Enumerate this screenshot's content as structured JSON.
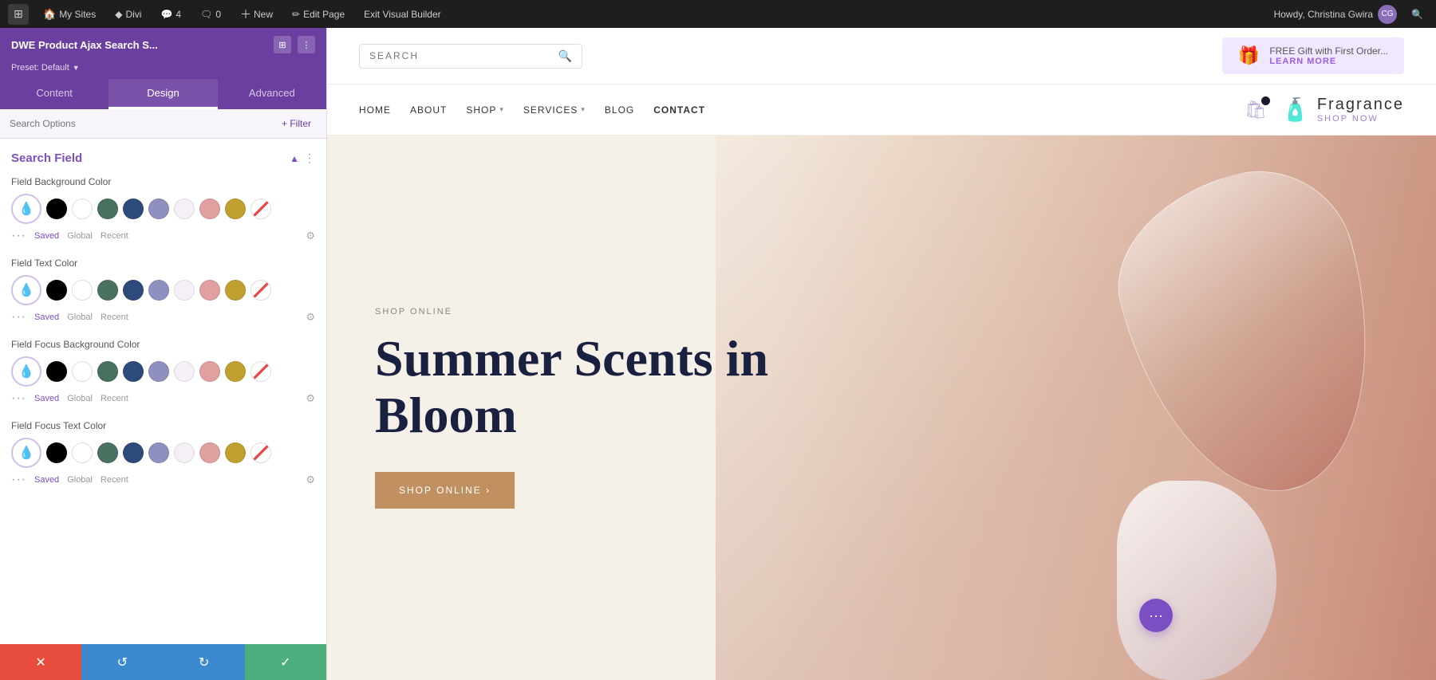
{
  "admin_bar": {
    "wp_logo": "⊞",
    "my_sites_label": "My Sites",
    "divi_label": "Divi",
    "comments_count": "4",
    "comments_label": "4",
    "new_label": "New",
    "edit_page_label": "Edit Page",
    "exit_builder_label": "Exit Visual Builder",
    "howdy_text": "Howdy, Christina Gwira",
    "search_icon": "🔍"
  },
  "panel": {
    "module_name": "DWE Product Ajax Search S...",
    "preset_label": "Preset: Default",
    "tabs": [
      {
        "label": "Content",
        "id": "content"
      },
      {
        "label": "Design",
        "id": "design",
        "active": true
      },
      {
        "label": "Advanced",
        "id": "advanced"
      }
    ],
    "search_placeholder": "Search Options",
    "filter_label": "+ Filter",
    "section_title": "Search Field",
    "field_groups": [
      {
        "label": "Field Background Color",
        "swatches": [
          "#000000",
          "#ffffff",
          "#4a7060",
          "#2d4a7a",
          "#9090c0",
          "#f5f0f5",
          "#e0a0a0",
          "#c0a030",
          "strikethrough"
        ],
        "eyedropper_icon": "💧"
      },
      {
        "label": "Field Text Color",
        "swatches": [
          "#000000",
          "#ffffff",
          "#4a7060",
          "#2d4a7a",
          "#9090c0",
          "#f5f0f5",
          "#e0a0a0",
          "#c0a030",
          "strikethrough"
        ],
        "eyedropper_icon": "💧"
      },
      {
        "label": "Field Focus Background Color",
        "swatches": [
          "#000000",
          "#ffffff",
          "#4a7060",
          "#2d4a7a",
          "#9090c0",
          "#f5f0f5",
          "#e0a0a0",
          "#c0a030",
          "strikethrough"
        ],
        "eyedropper_icon": "💧"
      },
      {
        "label": "Field Focus Text Color",
        "swatches": [
          "#000000",
          "#ffffff",
          "#4a7060",
          "#2d4a7a",
          "#9090c0",
          "#f5f0f5",
          "#e0a0a0",
          "#c0a030",
          "strikethrough"
        ],
        "eyedropper_icon": "💧"
      }
    ],
    "color_tab_saved": "Saved",
    "color_tab_global": "Global",
    "color_tab_recent": "Recent",
    "action_buttons": {
      "cancel": "✕",
      "undo": "↺",
      "redo": "↻",
      "save": "✓"
    }
  },
  "site": {
    "search_placeholder": "SEARCH",
    "promo_text": "FREE Gift with First Order...",
    "promo_link": "LEARN MORE",
    "nav_items": [
      {
        "label": "HOME",
        "has_dropdown": false
      },
      {
        "label": "ABOUT",
        "has_dropdown": false
      },
      {
        "label": "SHOP",
        "has_dropdown": true
      },
      {
        "label": "SERVICES",
        "has_dropdown": true
      },
      {
        "label": "BLOG",
        "has_dropdown": false
      },
      {
        "label": "CONTACT",
        "has_dropdown": false
      }
    ],
    "fragrance_name": "Fragrance",
    "fragrance_link": "SHOP NOW",
    "hero_subtitle": "SHOP ONLINE",
    "hero_title_line1": "Summer Scents in",
    "hero_title_line2": "Bloom",
    "hero_cta": "SHOP ONLINE ›",
    "float_btn": "···"
  }
}
